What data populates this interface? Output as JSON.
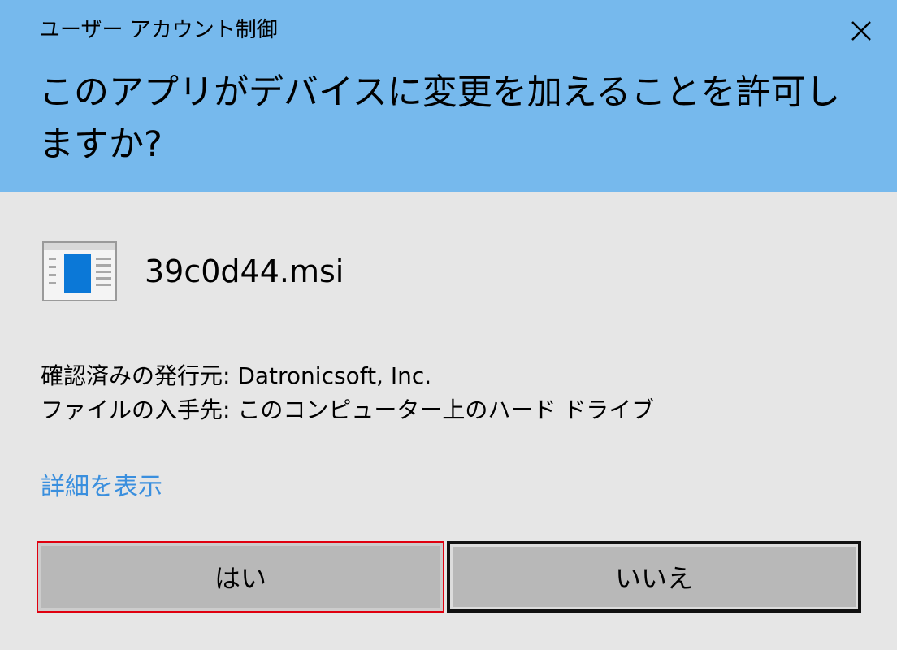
{
  "dialog": {
    "window_title": "ユーザー アカウント制御",
    "question": "このアプリがデバイスに変更を加えることを許可しますか?",
    "app_name": "39c0d44.msi",
    "publisher_line": "確認済みの発行元: Datronicsoft, Inc.",
    "origin_line": "ファイルの入手先: このコンピューター上のハード ドライブ",
    "details_link": "詳細を表示",
    "yes_label": "はい",
    "no_label": "いいえ"
  },
  "icons": {
    "close": "close-icon",
    "app": "installer-app-icon"
  },
  "colors": {
    "header_bg": "#76b9ed",
    "body_bg": "#e6e6e6",
    "link": "#3a8fde",
    "button_bg": "#b8b8b8",
    "highlight_border": "#e0000f",
    "focus_border": "#111111"
  }
}
